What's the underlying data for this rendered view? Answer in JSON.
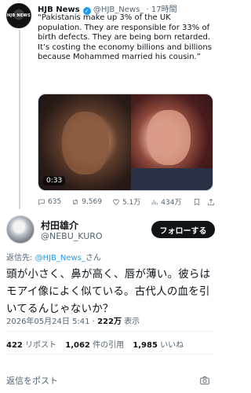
{
  "quoted_tweet": {
    "avatar_text": "HJB NEWS",
    "name": "HJB News",
    "handle": "@HJB_News_",
    "separator": "·",
    "time": "17時間",
    "text_lines": [
      "“Pakistanis make up 3% of the UK population. They are responsible for 33% of birth defects. They are being born retarded.",
      "It’s costing the economy billions and billions because Mohammed married his cousin.”"
    ],
    "video_duration": "0:33",
    "stats": {
      "replies": "635",
      "retweets": "9,569",
      "likes": "5.1万",
      "views": "434万"
    }
  },
  "main_tweet": {
    "name": "村田雄介",
    "handle": "@NEBU_KURO",
    "follow_label": "フォローする",
    "reply_prefix": "返信先: ",
    "reply_target": "@HJB_News_",
    "reply_suffix": "さん",
    "text": "頭が小さく、鼻が高く、唇が薄い。彼らはモアイ像によく似ている。古代人の血を引いてるんじゃないか？",
    "timestamp": "2026年05月24日 5:41 · ",
    "views_count": "222万",
    "views_label": " 表示",
    "counts": {
      "reposts_value": "422",
      "reposts_label": " リポスト",
      "quotes_value": "1,062",
      "quotes_label": " 件の引用",
      "likes_value": "1,985",
      "likes_label": " いいね"
    },
    "reply_placeholder": "返信をポスト"
  },
  "colors": {
    "accent": "#1d9bf0",
    "text": "#0f1419",
    "muted": "#536471",
    "divider": "#eff3f4"
  },
  "icons": [
    "reply-icon",
    "retweet-icon",
    "like-icon",
    "views-icon",
    "bookmark-icon",
    "share-icon",
    "camera-icon",
    "verified-icon"
  ]
}
